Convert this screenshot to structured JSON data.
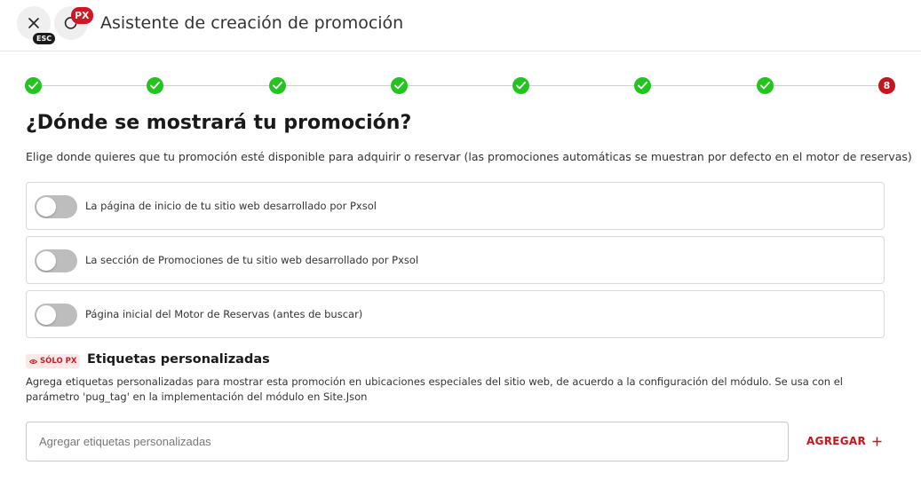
{
  "header": {
    "title": "Asistente de creación de promoción",
    "esc_badge": "ESC",
    "px_badge": "PX"
  },
  "stepper": {
    "completed_steps": 7,
    "current_step_label": "8"
  },
  "main": {
    "title": "¿Dónde se mostrará tu promoción?",
    "description": "Elige donde quieres que tu promoción esté disponible para adquirir o reservar (las promociones automáticas se muestran por defecto en el motor de reservas)",
    "options": [
      {
        "label": "La página de inicio de tu sitio web desarrollado por Pxsol",
        "enabled": false
      },
      {
        "label": "La sección de Promociones de tu sitio web desarrollado por Pxsol",
        "enabled": false
      },
      {
        "label": "Página inicial del Motor de Reservas (antes de buscar)",
        "enabled": false
      }
    ]
  },
  "tags": {
    "badge": "SÓLO PX",
    "title": "Etiquetas personalizadas",
    "description": "Agrega etiquetas personalizadas para mostrar esta promoción en ubicaciones especiales del sitio web, de acuerdo a la configuración del módulo. Se usa con el parámetro 'pug_tag' en la implementación del módulo en Site.Json",
    "input_placeholder": "Agregar etiquetas personalizadas",
    "input_value": "",
    "add_label": "AGREGAR"
  },
  "icons": {
    "close": "close-icon",
    "refresh": "refresh-icon",
    "check": "check-icon",
    "eye": "eye-icon",
    "plus": "plus-icon"
  },
  "colors": {
    "step_done": "#22c41e",
    "step_current": "#c8141b",
    "accent": "#c8141b",
    "toggle_off": "#bdbdbd"
  }
}
